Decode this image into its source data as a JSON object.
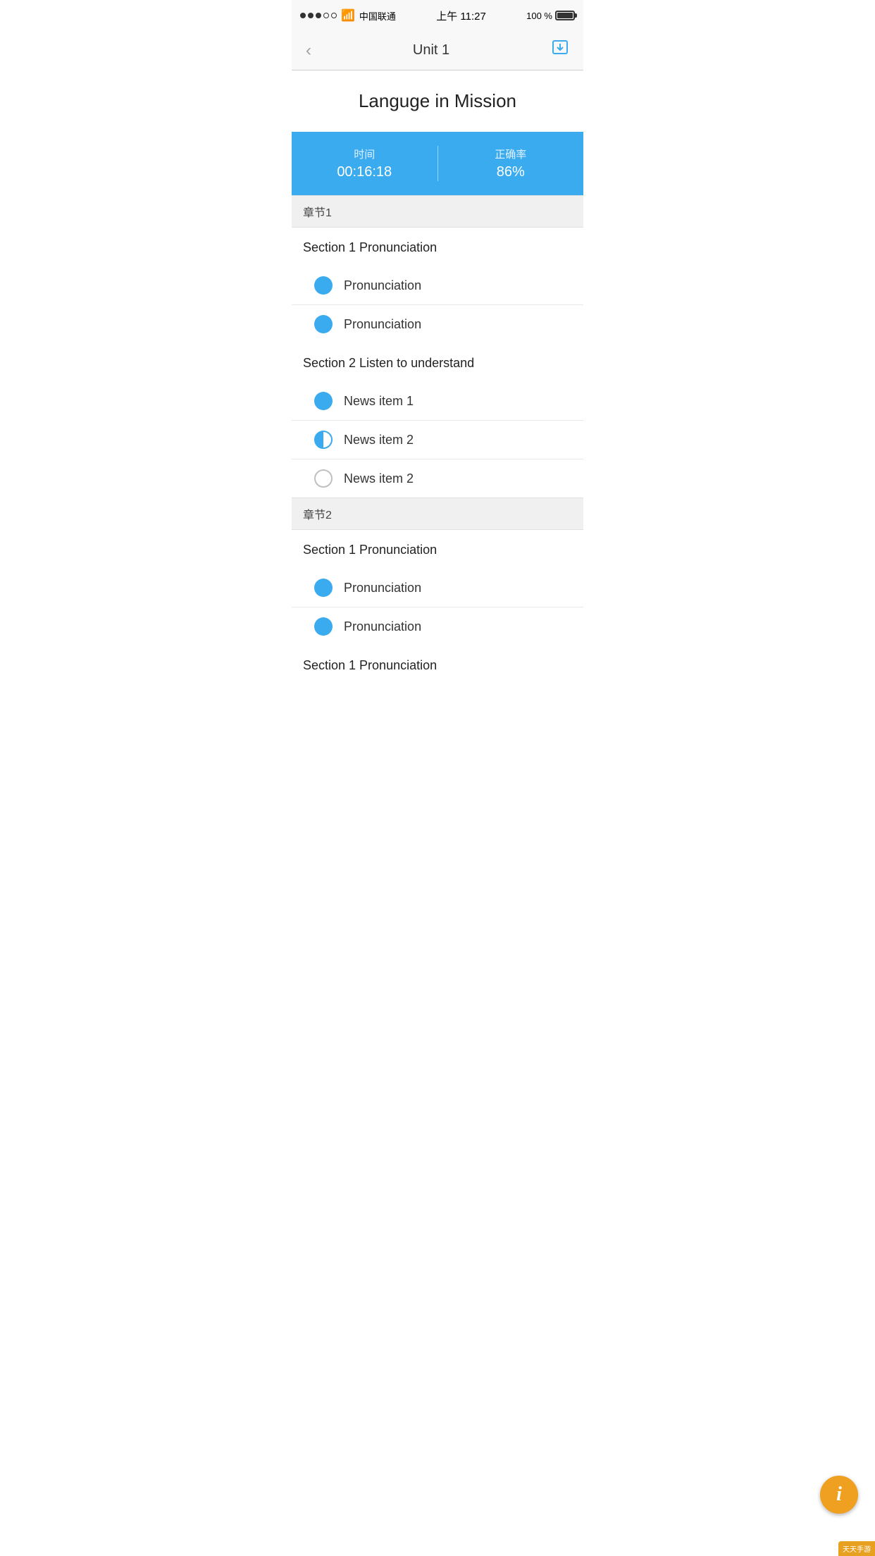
{
  "statusBar": {
    "carrier": "中国联通",
    "time": "上午 11:27",
    "battery": "100 %"
  },
  "navBar": {
    "title": "Unit 1",
    "backLabel": "‹",
    "downloadIcon": "download"
  },
  "pageTitle": "Languge in Mission",
  "stats": {
    "timeLabel": "时间",
    "timeValue": "00:16:18",
    "rateLabel": "正确率",
    "rateValue": "86%"
  },
  "chapters": [
    {
      "chapterLabel": "章节1",
      "sections": [
        {
          "sectionTitle": "Section 1 Pronunciation",
          "items": [
            {
              "label": "Pronunciation",
              "iconType": "full"
            },
            {
              "label": "Pronunciation",
              "iconType": "full"
            }
          ]
        },
        {
          "sectionTitle": "Section 2 Listen to understand",
          "items": [
            {
              "label": "News item 1",
              "iconType": "full"
            },
            {
              "label": "News item 2",
              "iconType": "half"
            },
            {
              "label": "News item 2",
              "iconType": "empty"
            }
          ]
        }
      ]
    },
    {
      "chapterLabel": "章节2",
      "sections": [
        {
          "sectionTitle": "Section 1 Pronunciation",
          "items": [
            {
              "label": "Pronunciation",
              "iconType": "full"
            },
            {
              "label": "Pronunciation",
              "iconType": "full"
            }
          ]
        },
        {
          "sectionTitle": "Section 1 Pronunciation",
          "items": []
        }
      ]
    }
  ],
  "infoButton": {
    "label": "i"
  },
  "watermark": {
    "text": "天天手游"
  }
}
